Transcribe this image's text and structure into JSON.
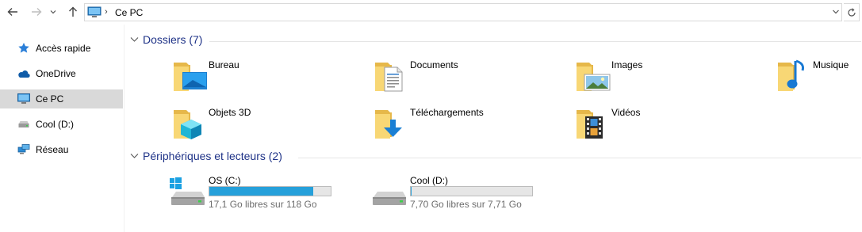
{
  "address_bar": {
    "back_label": "←",
    "forward_label": "→",
    "up_label": "↑",
    "path": [
      "Ce PC"
    ]
  },
  "sidebar": {
    "items": [
      {
        "label": "Accès rapide",
        "icon": "star-icon",
        "selected": false
      },
      {
        "label": "OneDrive",
        "icon": "cloud-icon",
        "selected": false
      },
      {
        "label": "Ce PC",
        "icon": "computer-icon",
        "selected": true
      },
      {
        "label": "Cool (D:)",
        "icon": "drive-icon",
        "selected": false
      },
      {
        "label": "Réseau",
        "icon": "network-icon",
        "selected": false
      }
    ]
  },
  "folders_group": {
    "title": "Dossiers (7)",
    "items": [
      {
        "name": "Bureau",
        "icon": "desktop-folder-icon"
      },
      {
        "name": "Documents",
        "icon": "documents-folder-icon"
      },
      {
        "name": "Images",
        "icon": "pictures-folder-icon"
      },
      {
        "name": "Musique",
        "icon": "music-folder-icon"
      },
      {
        "name": "Objets 3D",
        "icon": "3d-objects-folder-icon"
      },
      {
        "name": "Téléchargements",
        "icon": "downloads-folder-icon"
      },
      {
        "name": "Vidéos",
        "icon": "videos-folder-icon"
      }
    ]
  },
  "drives_group": {
    "title": "Périphériques et lecteurs (2)",
    "items": [
      {
        "name": "OS (C:)",
        "free_text": "17,1 Go libres sur 118 Go",
        "used_fraction": 0.855,
        "icon": "windows-drive-icon"
      },
      {
        "name": "Cool (D:)",
        "free_text": "7,70 Go libres sur 7,71 Go",
        "used_fraction": 0.0014,
        "icon": "drive-icon"
      }
    ]
  },
  "colors": {
    "group_title": "#1e3287",
    "usage_bar": "#26a0da",
    "folder": "#f8d775",
    "selection": "#d9d9d9"
  }
}
